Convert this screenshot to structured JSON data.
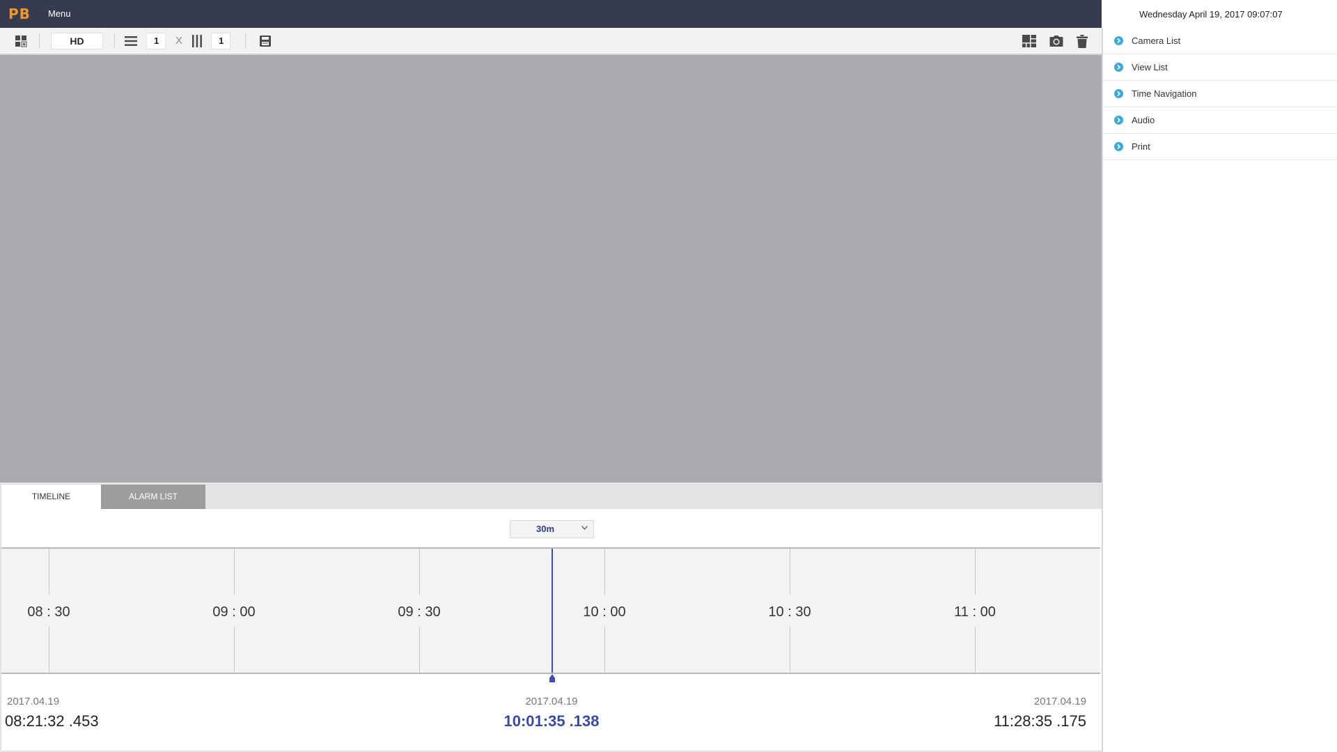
{
  "header": {
    "logo": "PB",
    "menu_label": "Menu",
    "datetime": "Wednesday  April  19, 2017  09:07:07"
  },
  "toolbar": {
    "quality": "HD",
    "rows": "1",
    "times": "X",
    "cols": "1"
  },
  "tabs": {
    "timeline": "TIMELINE",
    "alarm_list": "ALARM LIST",
    "active": "TIMELINE"
  },
  "timeline": {
    "zoom": "30m",
    "tick_labels": [
      "08 : 30",
      "09 : 00",
      "09 : 30",
      "10 : 00",
      "10 : 30",
      "11 : 00"
    ],
    "start": {
      "date": "2017.04.19",
      "time": "08:21:32 .453"
    },
    "current": {
      "date": "2017.04.19",
      "time": "10:01:35 .138"
    },
    "end": {
      "date": "2017.04.19",
      "time": "11:28:35 .175"
    }
  },
  "sidebar": {
    "items": [
      {
        "label": "Camera List"
      },
      {
        "label": "View List"
      },
      {
        "label": "Time Navigation"
      },
      {
        "label": "Audio"
      },
      {
        "label": "Print"
      }
    ]
  },
  "colors": {
    "topbar_bg": "#363b50",
    "logo": "#f0972b",
    "accent_blue": "#3949a8",
    "sidebar_icon": "#3aa9de",
    "video_bg": "#aaa9ae"
  }
}
